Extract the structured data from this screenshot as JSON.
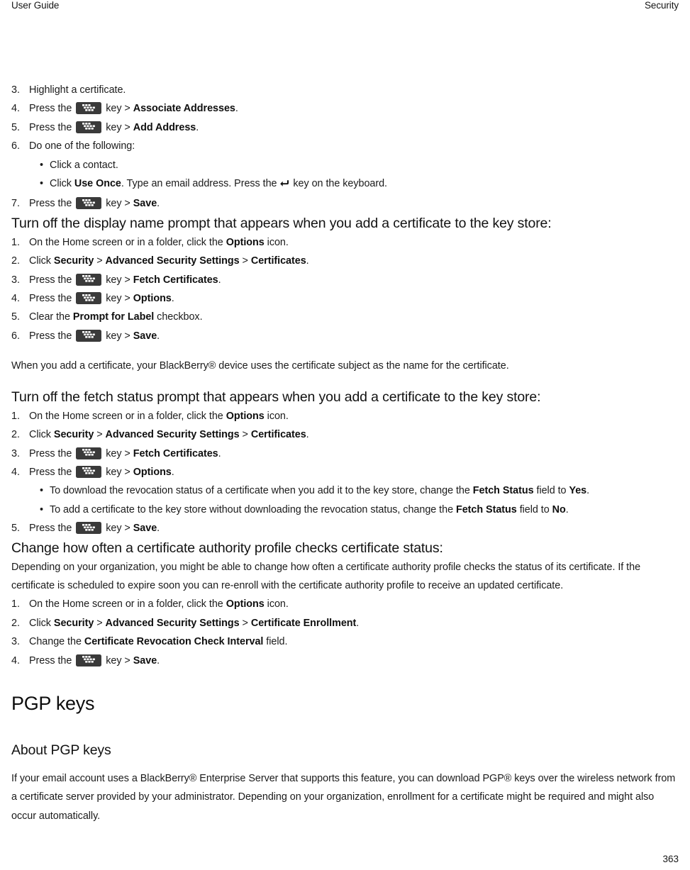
{
  "running_head": {
    "left": "User Guide",
    "right": "Security"
  },
  "icons": {
    "menu_key": "blackberry-menu-key-icon",
    "enter_key": "enter-key-icon"
  },
  "blocks": {
    "assoc_steps": {
      "items": [
        {
          "num": "3.",
          "text_before": "Highlight a certificate."
        },
        {
          "num": "4.",
          "text_before": "Press the ",
          "has_key": true,
          "text_mid": " key > ",
          "bold": "Associate Addresses",
          "text_after": "."
        },
        {
          "num": "5.",
          "text_before": "Press the ",
          "has_key": true,
          "text_mid": " key > ",
          "bold": "Add Address",
          "text_after": "."
        },
        {
          "num": "6.",
          "text_before": "Do one of the following:"
        }
      ],
      "bullets": [
        {
          "text_before": "Click a contact."
        },
        {
          "text_before": "Click ",
          "bold": "Use Once",
          "text_after": ". Type an email address. Press the ",
          "has_enter": true,
          "text_end": " key on the keyboard."
        }
      ],
      "final": {
        "num": "7.",
        "text_before": "Press the ",
        "has_key": true,
        "text_mid": " key > ",
        "bold": "Save",
        "text_after": "."
      }
    },
    "display_name_prompt": {
      "heading": "Turn off the display name prompt that appears when you add a certificate to the key store:",
      "steps": [
        {
          "num": "1.",
          "text_before": "On the Home screen or in a folder, click the ",
          "bold": "Options",
          "text_after": " icon."
        },
        {
          "num": "2.",
          "text_before": "Click ",
          "bold": "Security",
          "text_after": " > ",
          "bold2": "Advanced Security Settings",
          "text_after2": " > ",
          "bold3": "Certificates",
          "text_after3": "."
        },
        {
          "num": "3.",
          "text_before": "Press the ",
          "has_key": true,
          "text_mid": " key > ",
          "bold": "Fetch Certificates",
          "text_after": "."
        },
        {
          "num": "4.",
          "text_before": "Press the ",
          "has_key": true,
          "text_mid": " key > ",
          "bold": "Options",
          "text_after": "."
        },
        {
          "num": "5.",
          "text_before": "Clear the ",
          "bold": "Prompt for Label",
          "text_after": " checkbox."
        },
        {
          "num": "6.",
          "text_before": "Press the ",
          "has_key": true,
          "text_mid": " key > ",
          "bold": "Save",
          "text_after": "."
        }
      ]
    },
    "note_paragraph": "When you add a certificate, your BlackBerry® device uses the certificate subject as the name for the certificate.",
    "fetch_status_prompt": {
      "heading": "Turn off the fetch status prompt that appears when you add a certificate to the key store:",
      "steps": [
        {
          "num": "1.",
          "text_before": "On the Home screen or in a folder, click the ",
          "bold": "Options",
          "text_after": " icon."
        },
        {
          "num": "2.",
          "text_before": "Click ",
          "bold": "Security",
          "text_after": " > ",
          "bold2": "Advanced Security Settings",
          "text_after2": " > ",
          "bold3": "Certificates",
          "text_after3": "."
        },
        {
          "num": "3.",
          "text_before": "Press the ",
          "has_key": true,
          "text_mid": " key > ",
          "bold": "Fetch Certificates",
          "text_after": "."
        },
        {
          "num": "4.",
          "text_before": "Press the ",
          "has_key": true,
          "text_mid": " key > ",
          "bold": "Options",
          "text_after": "."
        }
      ],
      "bullets": [
        {
          "text_before": "To download the revocation status of a certificate when you add it to the key store, change the ",
          "bold": "Fetch Status",
          "text_after": " field to ",
          "bold2": "Yes",
          "text_after2": "."
        },
        {
          "text_before": "To add a certificate to the key store without downloading the revocation status, change the ",
          "bold": "Fetch Status",
          "text_after": " field to ",
          "bold2": "No",
          "text_after2": "."
        }
      ],
      "final": {
        "num": "5.",
        "text_before": "Press the ",
        "has_key": true,
        "text_mid": " key > ",
        "bold": "Save",
        "text_after": "."
      }
    },
    "ca_profile_interval": {
      "heading": "Change how often a certificate authority profile checks certificate status:",
      "paragraph": "Depending on your organization, you might be able to change how often a certificate authority profile checks the status of its certificate. If the certificate is scheduled to expire soon you can re-enroll with the certificate authority profile to receive an updated certificate.",
      "steps": [
        {
          "num": "1.",
          "text_before": "On the Home screen or in a folder, click the ",
          "bold": "Options",
          "text_after": " icon."
        },
        {
          "num": "2.",
          "text_before": "Click ",
          "bold": "Security",
          "text_after": " > ",
          "bold2": "Advanced Security Settings",
          "text_after2": " > ",
          "bold3": "Certificate Enrollment",
          "text_after3": "."
        },
        {
          "num": "3.",
          "text_before": "Change the ",
          "bold": "Certificate Revocation Check Interval",
          "text_after": " field."
        },
        {
          "num": "4.",
          "text_before": "Press the ",
          "has_key": true,
          "text_mid": " key > ",
          "bold": "Save",
          "text_after": "."
        }
      ]
    },
    "pgp_keys": {
      "title": "PGP keys",
      "about_heading": "About PGP keys",
      "about_paragraph": "If your email account uses a BlackBerry® Enterprise Server that supports this feature, you can download PGP® keys over the wireless network from a certificate server provided by your administrator. Depending on your organization, enrollment for a certificate might be required and might also occur automatically."
    }
  },
  "folio": "363"
}
